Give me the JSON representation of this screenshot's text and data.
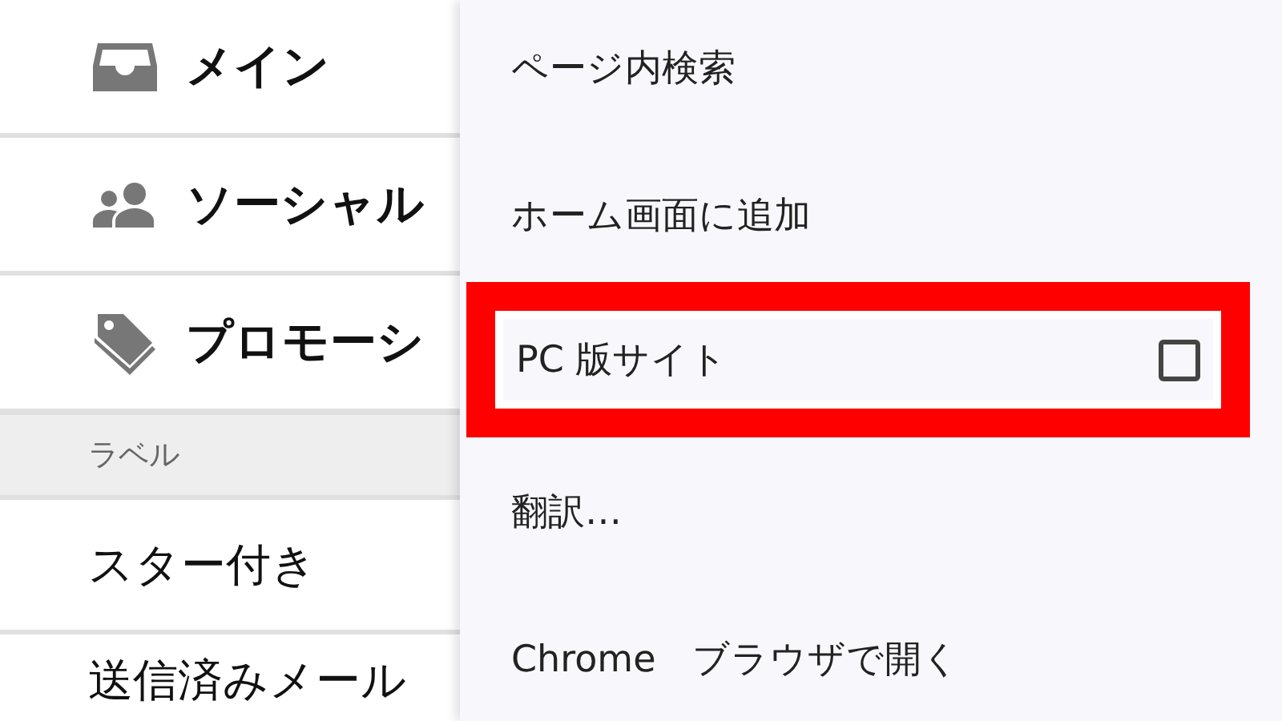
{
  "sidebar": {
    "categories": [
      {
        "kind": "inbox",
        "label": "メイン"
      },
      {
        "kind": "people",
        "label": "ソーシャル"
      },
      {
        "kind": "tag",
        "label": "プロモーシ"
      }
    ],
    "section_header": "ラベル",
    "items": [
      {
        "label": "スター付き"
      },
      {
        "label": "送信済みメール"
      }
    ]
  },
  "menu": {
    "items": [
      {
        "kind": "plain",
        "label": "ページ内検索",
        "highlighted": false
      },
      {
        "kind": "plain",
        "label": "ホーム画面に追加",
        "highlighted": false
      },
      {
        "kind": "checkbox",
        "label": "PC 版サイト",
        "checked": false,
        "highlighted": true
      },
      {
        "kind": "plain",
        "label": "翻訳…",
        "highlighted": false
      },
      {
        "kind": "plain",
        "label": "Chrome　ブラウザで開く",
        "highlighted": false
      }
    ]
  }
}
